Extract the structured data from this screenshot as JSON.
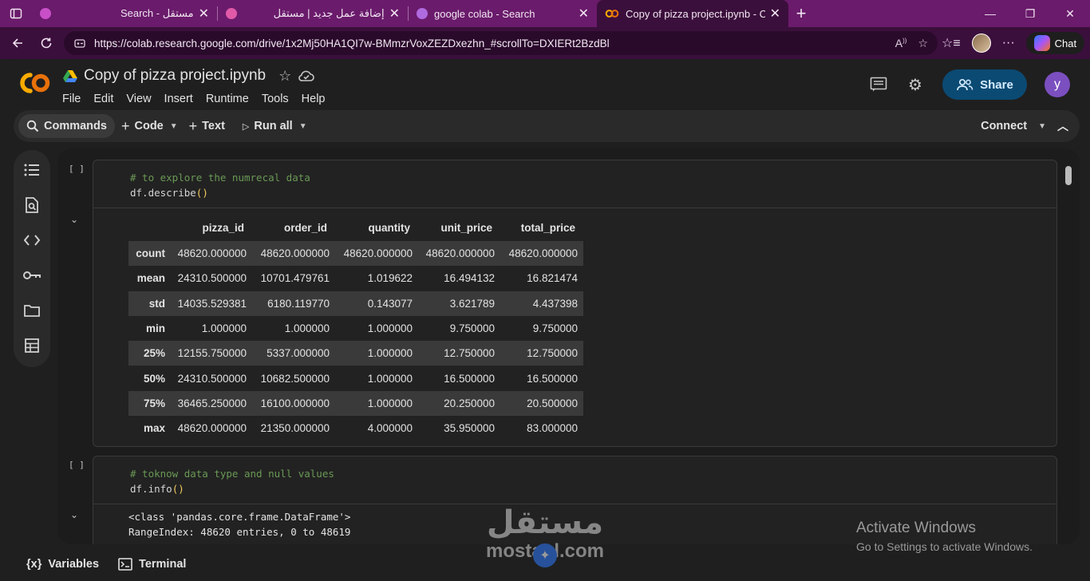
{
  "browser": {
    "tabs": [
      {
        "title": "Search - مستقل",
        "active": false,
        "favicon_color": "#c94fc9"
      },
      {
        "title": "إضافة عمل جديد | مستقل",
        "active": false,
        "favicon_color": "#e05aa8"
      },
      {
        "title": "google colab - Search",
        "active": false,
        "favicon_color": "#b06ae0"
      },
      {
        "title": "Copy of pizza project.ipynb - Cola",
        "active": true,
        "favicon_color": "#f9ab00"
      }
    ],
    "url": "https://colab.research.google.com/drive/1x2Mj50HA1QI7w-BMmzrVoxZEZDxezhn_#scrollTo=DXIERt2BzdBl",
    "chat_label": "Chat"
  },
  "header": {
    "notebook_title": "Copy of pizza project.ipynb",
    "menu": [
      "File",
      "Edit",
      "View",
      "Insert",
      "Runtime",
      "Tools",
      "Help"
    ],
    "share_label": "Share",
    "user_initial": "y"
  },
  "toolbar": {
    "commands_label": "Commands",
    "code_label": "Code",
    "text_label": "Text",
    "run_all_label": "Run all",
    "connect_label": "Connect"
  },
  "cells": [
    {
      "bracket": "[ ]",
      "comment": "# to explore the numrecal data",
      "code_prefix": "df.describe",
      "code_parens": "()"
    },
    {
      "bracket": "[ ]",
      "comment": "# toknow data type and null values",
      "code_prefix": "df.info",
      "code_parens": "()",
      "output_lines": [
        "<class 'pandas.core.frame.DataFrame'>",
        "RangeIndex: 48620 entries, 0 to 48619"
      ]
    }
  ],
  "describe_table": {
    "columns": [
      "pizza_id",
      "order_id",
      "quantity",
      "unit_price",
      "total_price"
    ],
    "rows": [
      {
        "index": "count",
        "values": [
          "48620.000000",
          "48620.000000",
          "48620.000000",
          "48620.000000",
          "48620.000000"
        ]
      },
      {
        "index": "mean",
        "values": [
          "24310.500000",
          "10701.479761",
          "1.019622",
          "16.494132",
          "16.821474"
        ]
      },
      {
        "index": "std",
        "values": [
          "14035.529381",
          "6180.119770",
          "0.143077",
          "3.621789",
          "4.437398"
        ]
      },
      {
        "index": "min",
        "values": [
          "1.000000",
          "1.000000",
          "1.000000",
          "9.750000",
          "9.750000"
        ]
      },
      {
        "index": "25%",
        "values": [
          "12155.750000",
          "5337.000000",
          "1.000000",
          "12.750000",
          "12.750000"
        ]
      },
      {
        "index": "50%",
        "values": [
          "24310.500000",
          "10682.500000",
          "1.000000",
          "16.500000",
          "16.500000"
        ]
      },
      {
        "index": "75%",
        "values": [
          "36465.250000",
          "16100.000000",
          "1.000000",
          "20.250000",
          "20.500000"
        ]
      },
      {
        "index": "max",
        "values": [
          "48620.000000",
          "21350.000000",
          "4.000000",
          "35.950000",
          "83.000000"
        ]
      }
    ]
  },
  "bottombar": {
    "variables_label": "Variables",
    "terminal_label": "Terminal"
  },
  "overlays": {
    "activate_title": "Activate Windows",
    "activate_subtitle": "Go to Settings to activate Windows.",
    "watermark_text": "مستقل",
    "watermark_domain": "mostaql.com"
  },
  "colors": {
    "browser_frame": "#6a1b6b",
    "share_button": "#0b4a73",
    "user_avatar": "#7b4fbf",
    "code_comment": "#6a9955",
    "colab_orange": "#f9ab00"
  },
  "icons": {
    "rail": [
      "table-of-contents-icon",
      "find-replace-icon",
      "code-snippets-icon",
      "secrets-key-icon",
      "files-folder-icon",
      "data-table-icon"
    ]
  }
}
